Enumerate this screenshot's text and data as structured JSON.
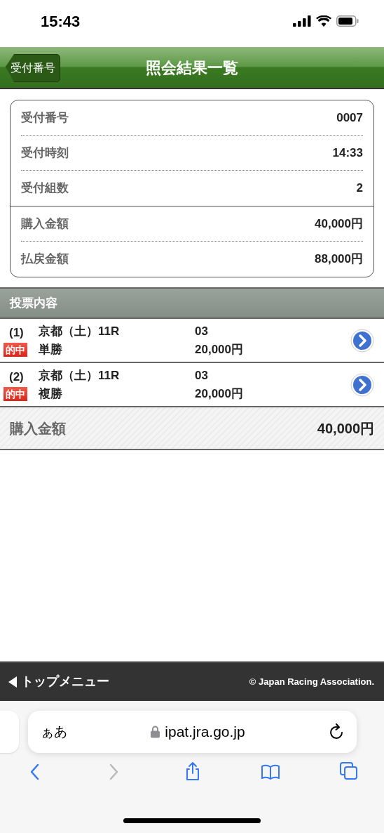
{
  "status_bar": {
    "time": "15:43"
  },
  "header": {
    "back_button": "受付番号",
    "title": "照会結果一覧"
  },
  "summary": {
    "reception": [
      {
        "label": "受付番号",
        "value": "0007"
      },
      {
        "label": "受付時刻",
        "value": "14:33"
      },
      {
        "label": "受付組数",
        "value": "2"
      }
    ],
    "amounts": [
      {
        "label": "購入金額",
        "value": "40,000円"
      },
      {
        "label": "払戻金額",
        "value": "88,000円"
      }
    ]
  },
  "section_title": "投票内容",
  "bets": [
    {
      "number": "(1)",
      "race": "京都（土）11R",
      "badge": "的中",
      "bet_type": "単勝",
      "horse": "03",
      "amount": "20,000円"
    },
    {
      "number": "(2)",
      "race": "京都（土）11R",
      "badge": "的中",
      "bet_type": "複勝",
      "horse": "03",
      "amount": "20,000円"
    }
  ],
  "total": {
    "label": "購入金額",
    "value": "40,000円"
  },
  "footer": {
    "menu_link": "トップメニュー",
    "copyright": "© Japan Racing Association."
  },
  "browser": {
    "text_size_button": "ぁあ",
    "url": "ipat.jra.go.jp",
    "nav": [
      {
        "kind": "back",
        "disabled": false
      },
      {
        "kind": "forward",
        "disabled": true
      },
      {
        "kind": "share",
        "disabled": false
      },
      {
        "kind": "bookmarks",
        "disabled": false
      },
      {
        "kind": "tabs",
        "disabled": false
      }
    ]
  }
}
